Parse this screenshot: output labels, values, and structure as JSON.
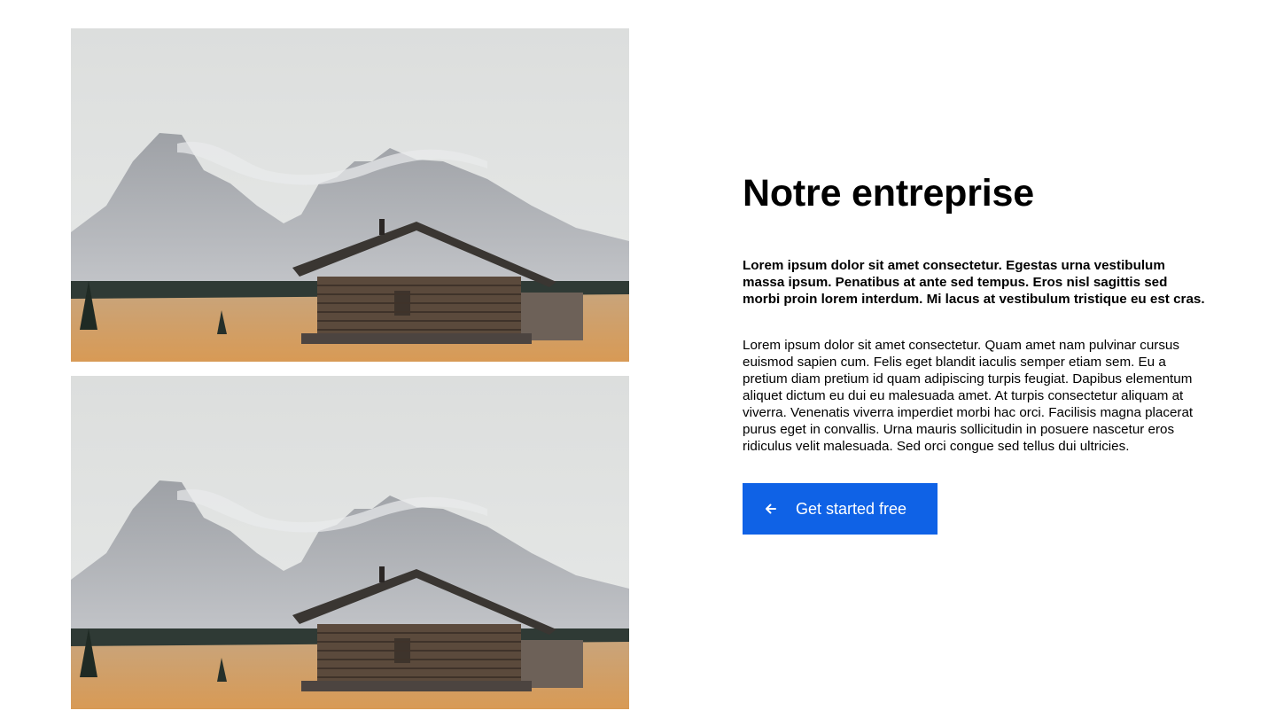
{
  "images": [
    {
      "alt": "wooden cabin in front of mountains"
    },
    {
      "alt": "wooden cabin in front of mountains"
    }
  ],
  "content": {
    "title": "Notre entreprise",
    "lead": "Lorem ipsum dolor sit amet consectetur. Egestas urna vestibulum massa ipsum. Penatibus at ante sed tempus. Eros nisl sagittis sed morbi proin lorem interdum. Mi lacus at vestibulum tristique eu est cras.",
    "body": "Lorem ipsum dolor sit amet consectetur. Quam amet nam pulvinar cursus euismod sapien cum. Felis eget blandit iaculis semper etiam sem. Eu a pretium diam pretium id quam adipiscing turpis feugiat. Dapibus elementum aliquet dictum eu dui eu malesuada amet. At turpis consectetur aliquam at viverra. Venenatis viverra imperdiet morbi hac orci. Facilisis magna placerat purus eget in convallis. Urna mauris sollicitudin in posuere nascetur eros ridiculus velit malesuada. Sed orci congue sed tellus dui ultricies.",
    "cta": {
      "label": "Get started free",
      "icon": "arrow-left-icon"
    }
  },
  "colors": {
    "accent": "#0f62e6",
    "text": "#000000",
    "background": "#ffffff"
  }
}
